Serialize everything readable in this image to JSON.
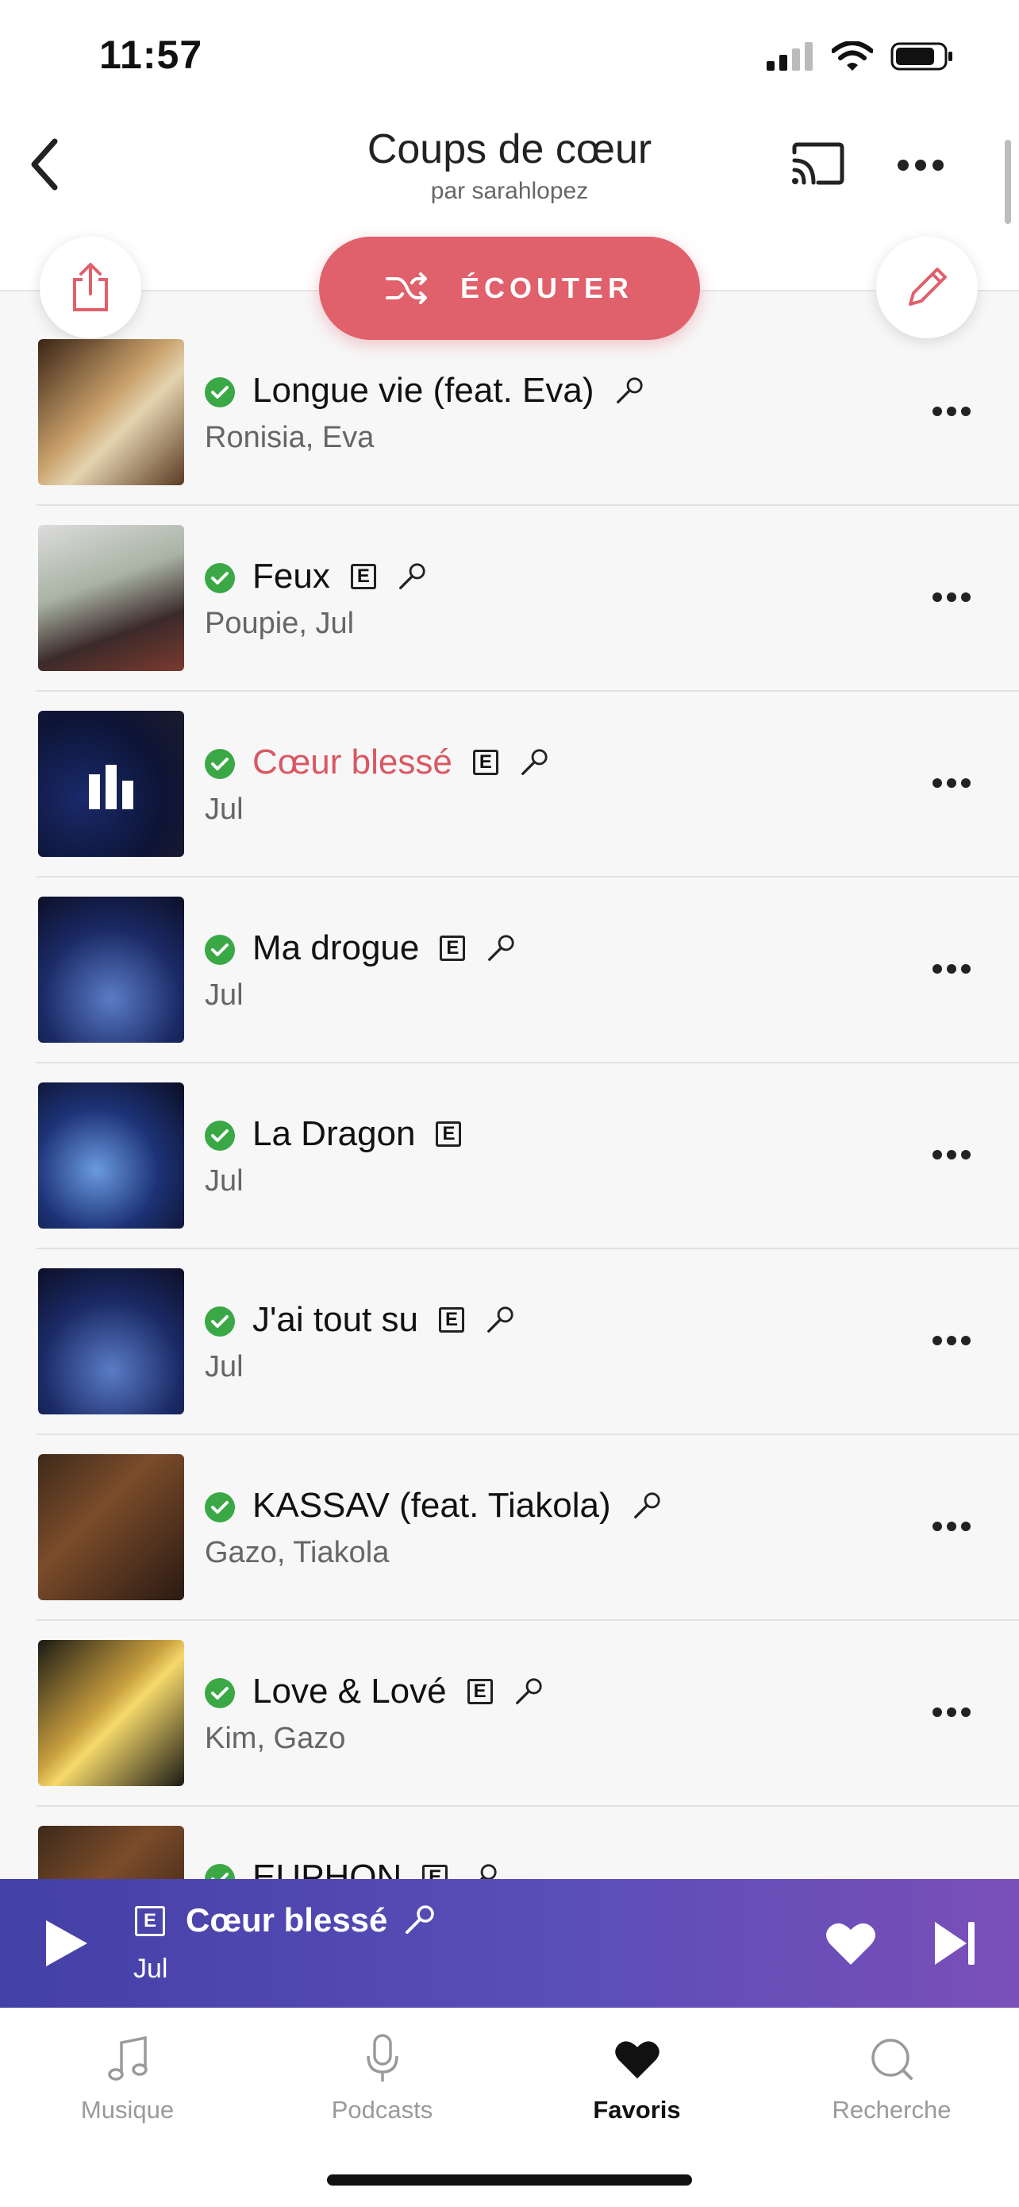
{
  "status": {
    "time": "11:57"
  },
  "header": {
    "title": "Coups de cœur",
    "subtitle": "par sarahlopez",
    "play_label": "ÉCOUTER"
  },
  "tracks": [
    {
      "title": "Longue vie (feat. Eva)",
      "artist": "Ronisia, Eva",
      "explicit": false,
      "lyrics": true,
      "downloaded": true,
      "playing": false
    },
    {
      "title": "Feux",
      "artist": "Poupie, Jul",
      "explicit": true,
      "lyrics": true,
      "downloaded": true,
      "playing": false
    },
    {
      "title": "Cœur blessé",
      "artist": "Jul",
      "explicit": true,
      "lyrics": true,
      "downloaded": true,
      "playing": true
    },
    {
      "title": "Ma drogue",
      "artist": "Jul",
      "explicit": true,
      "lyrics": true,
      "downloaded": true,
      "playing": false
    },
    {
      "title": "La Dragon",
      "artist": "Jul",
      "explicit": true,
      "lyrics": false,
      "downloaded": true,
      "playing": false
    },
    {
      "title": "J'ai tout su",
      "artist": "Jul",
      "explicit": true,
      "lyrics": true,
      "downloaded": true,
      "playing": false
    },
    {
      "title": "KASSAV (feat. Tiakola)",
      "artist": "Gazo, Tiakola",
      "explicit": false,
      "lyrics": true,
      "downloaded": true,
      "playing": false
    },
    {
      "title": "Love & Lové",
      "artist": "Kim, Gazo",
      "explicit": true,
      "lyrics": true,
      "downloaded": true,
      "playing": false
    },
    {
      "title": "EUPHON",
      "artist": "",
      "explicit": true,
      "lyrics": true,
      "downloaded": true,
      "playing": false
    }
  ],
  "player": {
    "title": "Cœur blessé",
    "artist": "Jul",
    "explicit_badge": "E"
  },
  "tabs": [
    {
      "label": "Musique",
      "icon": "music-note-icon"
    },
    {
      "label": "Podcasts",
      "icon": "microphone-icon"
    },
    {
      "label": "Favoris",
      "icon": "heart-icon"
    },
    {
      "label": "Recherche",
      "icon": "search-icon"
    }
  ],
  "explicit_badge": "E",
  "colors": {
    "accent": "#e0606b",
    "active_track": "#d95862",
    "download_check": "#3aa845",
    "player_start": "#4340a6",
    "player_end": "#7a4fb8"
  }
}
